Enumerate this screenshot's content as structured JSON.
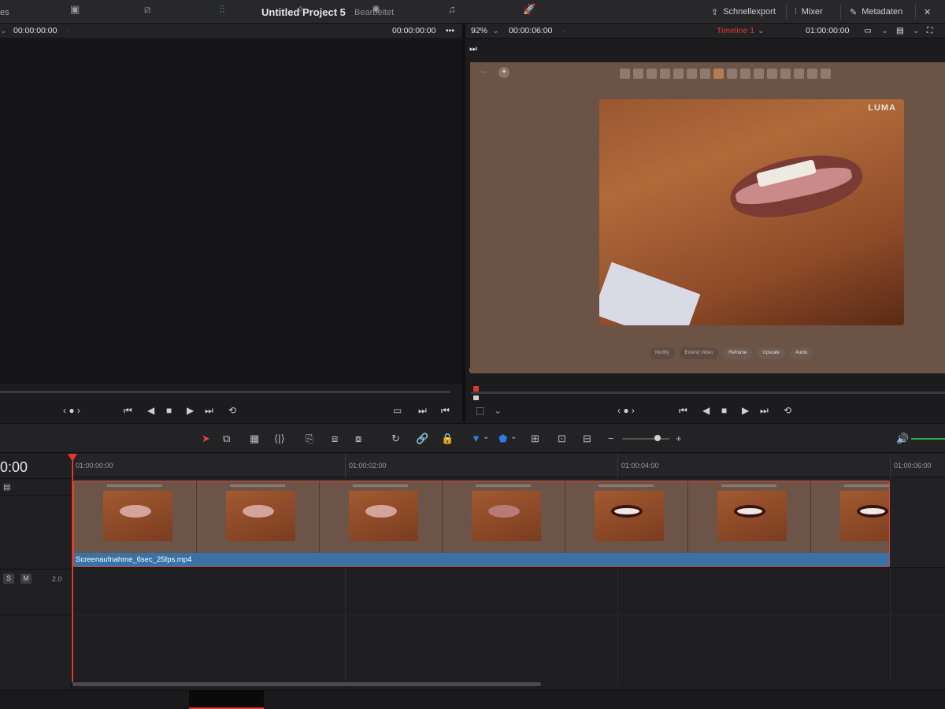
{
  "topbar": {
    "left_cut": "es",
    "project_title": "Untitled Project 5",
    "status": "Bearbeitet",
    "quick_export": "Schnellexport",
    "mixer": "Mixer",
    "metadata": "Metadaten"
  },
  "viewer_header": {
    "source_timecode_in": "00:00:00:00",
    "source_timecode_out": "00:00:00:00",
    "zoom": "92%",
    "program_duration": "00:00:06:00",
    "timeline_name": "Timeline 1",
    "program_timecode": "01:00:00:00"
  },
  "program_image": {
    "watermark": "LUMA",
    "pills": [
      "Modify",
      "Extend Video",
      "Reframe",
      "Upscale",
      "Audio"
    ]
  },
  "timeline": {
    "current_timecode": "0:00",
    "ruler": [
      "01:00:00:00",
      "01:00:02:00",
      "01:00:04:00",
      "01:00:06:00"
    ],
    "clip_name": "Screenaufnahme_6sec_25fps.mp4",
    "audio_solo": "S",
    "audio_mute": "M",
    "audio_channels": "2.0"
  },
  "colors": {
    "playhead": "#e0392f",
    "clip_bar": "#3b72a6",
    "timeline_name": "#e0392f",
    "volume_meter": "#2bb34a"
  }
}
